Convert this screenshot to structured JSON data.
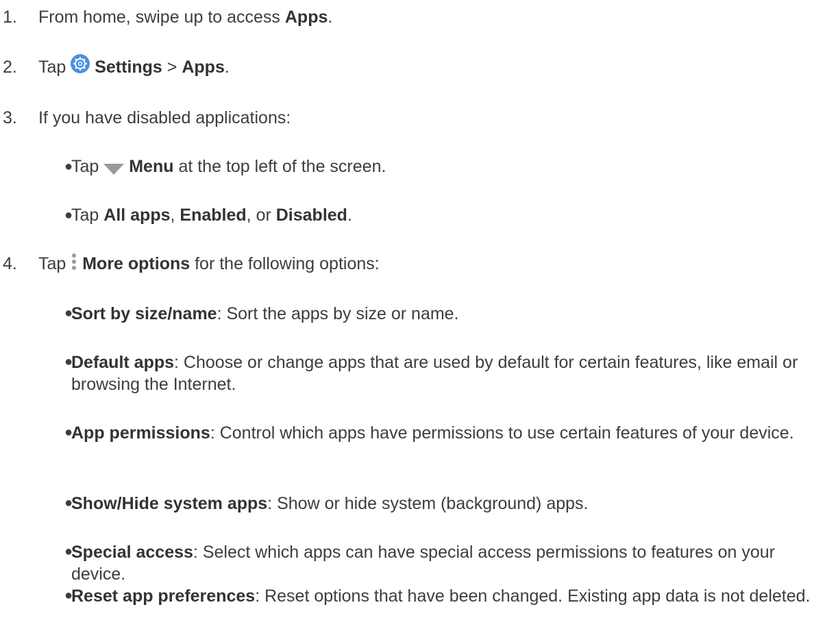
{
  "steps": [
    {
      "num": "1.",
      "pre": "From home, swipe up to access ",
      "bold": "Apps",
      "post": "."
    },
    {
      "num": "2.",
      "pre": "Tap ",
      "icon": "settings-gear-icon",
      "bold1": "Settings",
      "mid": " > ",
      "bold2": "Apps",
      "post": "."
    },
    {
      "num": "3.",
      "text": "If you have disabled applications:"
    },
    {
      "num": "4.",
      "pre": "Tap ",
      "icon": "more-options-icon",
      "bold": "More options",
      "post": " for the following options:"
    }
  ],
  "step3_bullets": [
    {
      "pre": "Tap ",
      "icon": "menu-dropdown-icon",
      "bold": "Menu",
      "post": " at the top left of the screen."
    },
    {
      "pre": "Tap ",
      "bold1": "All apps",
      "mid1": ", ",
      "bold2": "Enabled",
      "mid2": ", or ",
      "bold3": "Disabled",
      "post": "."
    }
  ],
  "step4_bullets": [
    {
      "bold": "Sort by size/name",
      "text": ": Sort the apps by size or name."
    },
    {
      "bold": "Default apps",
      "text": ": Choose or change apps that are used by default for certain features, like email or browsing the Internet."
    },
    {
      "bold": "App permissions",
      "text": ": Control which apps have permissions to use certain features of your device."
    },
    {
      "bold": "Show/Hide system apps",
      "text": ": Show or hide system (background) apps."
    },
    {
      "bold": "Special access",
      "text": ": Select which apps can have special access permissions to features on your device."
    },
    {
      "bold": "Reset app preferences",
      "text": ": Reset options that have been changed. Existing app data is not deleted."
    }
  ],
  "bullet_char": "●",
  "colors": {
    "text": "#3d3d3d",
    "settings_icon": "#4a90e2",
    "menu_icon": "#9a9a9a"
  }
}
